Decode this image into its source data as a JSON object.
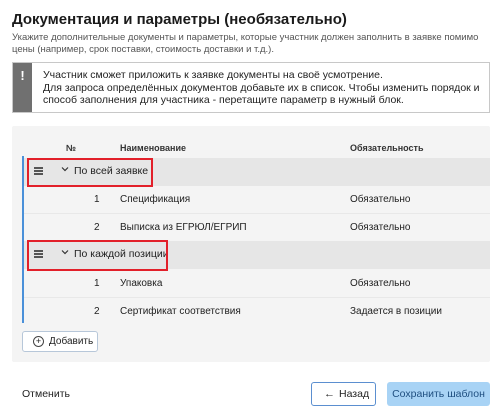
{
  "header": {
    "title": "Документация и параметры (необязательно)",
    "subtitle": "Укажите дополнительные документы и параметры, которые участник должен заполнить в заявке помимо цены (например, срок поставки, стоимость доставки и т.д.)."
  },
  "info": {
    "icon": "exclamation-icon",
    "line1": "Участник сможет приложить к заявке документы на своё усмотрение.",
    "line2": "Для запроса определённых документов добавьте их в список. Чтобы изменить порядок и способ заполнения для участника - перетащите параметр в нужный блок."
  },
  "table": {
    "columns": {
      "no": "№",
      "name": "Наименование",
      "required": "Обязательность"
    },
    "groups": [
      {
        "label": "По всей заявке",
        "rows": [
          {
            "no": "1",
            "name": "Спецификация",
            "required": "Обязательно"
          },
          {
            "no": "2",
            "name": "Выписка из ЕГРЮЛ/ЕГРИП",
            "required": "Обязательно"
          }
        ]
      },
      {
        "label": "По каждой позиции",
        "rows": [
          {
            "no": "1",
            "name": "Упаковка",
            "required": "Обязательно"
          },
          {
            "no": "2",
            "name": "Сертификат соответствия",
            "required": "Задается в позиции"
          }
        ]
      }
    ]
  },
  "actions": {
    "add_label": "Добавить",
    "cancel_label": "Отменить",
    "back_label": "Назад",
    "save_label": "Сохранить шаблон"
  },
  "colors": {
    "accent_blue": "#4a90d9",
    "save_button": "#a8d3f5",
    "highlight_red": "#e2202a",
    "info_sidebar": "#707070"
  }
}
